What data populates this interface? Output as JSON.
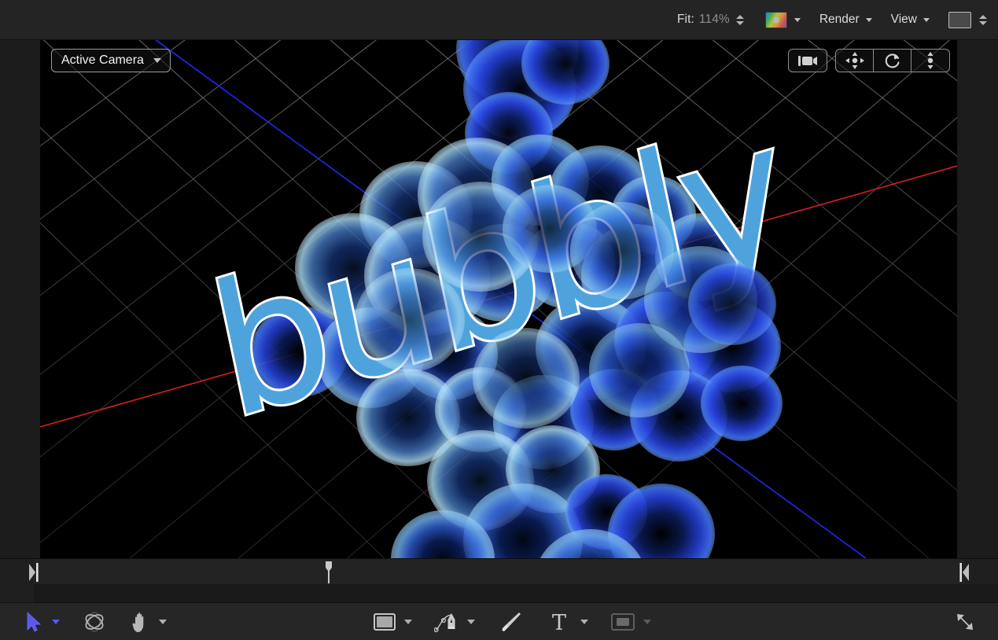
{
  "top_toolbar": {
    "fit_label": "Fit:",
    "fit_value": "114%",
    "fit_stepper_icon": "updown-stepper-icon",
    "color_swatch_icon": "color-wheel-swatch-icon",
    "color_swatch_chevron_icon": "chevron-down-icon",
    "render_menu": "Render",
    "render_chevron_icon": "chevron-down-icon",
    "view_menu": "View",
    "view_chevron_icon": "chevron-down-icon",
    "background_swatch_icon": "background-color-swatch-icon",
    "background_stepper_icon": "updown-stepper-icon"
  },
  "viewport": {
    "camera_selector_label": "Active Camera",
    "camera_selector_chevron_icon": "chevron-down-icon",
    "camera_tools": [
      {
        "name": "camera-icon",
        "title": "Camera"
      },
      {
        "name": "pan-camera-icon",
        "title": "Pan"
      },
      {
        "name": "orbit-camera-icon",
        "title": "Orbit"
      },
      {
        "name": "dolly-camera-icon",
        "title": "Dolly"
      }
    ],
    "scene": {
      "text": "bubbly",
      "text_fill_color": "#4fa3dd",
      "text_outline_color": "#ffffff",
      "bubble_color": "#2b55d8",
      "bubble_highlight_color": "#9dd2f2",
      "grid_color": "#6e6e6e",
      "x_axis_color": "#d81f1f",
      "z_axis_color": "#1f25d8",
      "background_color": "#000000"
    }
  },
  "timeline": {
    "in_point_icon": "in-point-marker-icon",
    "out_point_icon": "out-point-marker-icon",
    "playhead_icon": "playhead-icon"
  },
  "bottom_toolbar": {
    "left_tools": [
      {
        "name": "select-tool-icon",
        "label": "Select",
        "active": true
      },
      {
        "name": "select-tool-chevron-icon",
        "label": "",
        "active": true
      },
      {
        "name": "transform-3d-tool-icon",
        "label": "3D Transform",
        "active": false
      },
      {
        "name": "hand-tool-icon",
        "label": "Pan View",
        "active": false
      },
      {
        "name": "hand-tool-chevron-icon",
        "label": "",
        "active": false
      }
    ],
    "center_tools": [
      {
        "name": "shape-tool-icon",
        "label": "Rectangle"
      },
      {
        "name": "shape-tool-chevron-icon",
        "label": ""
      },
      {
        "name": "bezier-pen-tool-icon",
        "label": "Bezier"
      },
      {
        "name": "bezier-pen-tool-chevron-icon",
        "label": ""
      },
      {
        "name": "paint-stroke-tool-icon",
        "label": "Paint Stroke"
      },
      {
        "name": "text-tool-icon",
        "label": "Text"
      },
      {
        "name": "text-tool-chevron-icon",
        "label": ""
      },
      {
        "name": "mask-tool-icon",
        "label": "Mask"
      },
      {
        "name": "mask-tool-chevron-icon",
        "label": ""
      }
    ],
    "right_tools": [
      {
        "name": "resize-canvas-icon",
        "label": "Resize"
      }
    ]
  },
  "colors": {
    "toolbar_bg": "#242424",
    "bottom_bar_bg": "#262626",
    "panel_bg": "#1c1c1c",
    "accent_blue": "#5a57f0",
    "text_primary": "#dcdcdc",
    "text_dim": "#8e8e8e"
  }
}
